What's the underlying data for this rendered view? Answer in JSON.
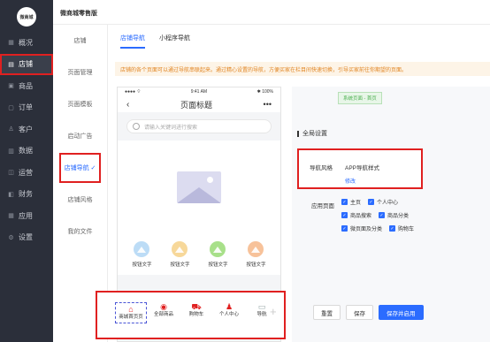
{
  "sidebar": {
    "logo_text": "微商城",
    "items": [
      {
        "icon": "grid-icon",
        "label": "概况"
      },
      {
        "icon": "store-icon",
        "label": "店铺"
      },
      {
        "icon": "goods-icon",
        "label": "商品"
      },
      {
        "icon": "order-icon",
        "label": "订单"
      },
      {
        "icon": "customer-icon",
        "label": "客户"
      },
      {
        "icon": "data-icon",
        "label": "数据"
      },
      {
        "icon": "marketing-icon",
        "label": "运营"
      },
      {
        "icon": "finance-icon",
        "label": "财务"
      },
      {
        "icon": "apps-icon",
        "label": "应用"
      },
      {
        "icon": "settings-icon",
        "label": "设置"
      }
    ]
  },
  "header": {
    "brand": "微商城零售版"
  },
  "subnav": {
    "items": [
      "店铺",
      "页面管理",
      "页面模板",
      "启动广告",
      "店铺导航 ✓",
      "店铺风格",
      "我的文件"
    ]
  },
  "tabs": [
    "店铺导航",
    "小程序导航"
  ],
  "notice": "店铺的各个页面可以通过导航串联起来。通过精心设置的导航，方便买家在栏目间快速切换，引导买家前往你期望的页面。",
  "phone": {
    "status_left": "●●●● ⌔",
    "status_time": "9:41 AM",
    "status_right": "✱ 100%",
    "title": "页面标题",
    "search_placeholder": "请输入关键词进行搜索",
    "buttons": [
      {
        "label": "按钮文字",
        "color": "#bcdcf6"
      },
      {
        "label": "按钮文字",
        "color": "#f7d89a"
      },
      {
        "label": "按钮文字",
        "color": "#a8e08a"
      },
      {
        "label": "按钮文字",
        "color": "#f7c29a"
      }
    ]
  },
  "bottom_nav": [
    {
      "icon": "home-icon",
      "label": "商城首页页"
    },
    {
      "icon": "all-goods-icon",
      "label": "全部商品"
    },
    {
      "icon": "cart-icon",
      "label": "购物车"
    },
    {
      "icon": "user-icon",
      "label": "个人中心"
    },
    {
      "icon": "guide-icon",
      "label": "导航"
    }
  ],
  "bottom_nav_add": "+",
  "panel": {
    "badge": "系统页面 - 首页",
    "section_title": "全局设置",
    "nav_style_label": "导航风格",
    "nav_style_value": "APP导航样式",
    "edit_link": "修改",
    "apply_label": "应用页面",
    "apply_rows": [
      [
        "主页",
        "个人中心"
      ],
      [
        "商品搜索",
        "商品分类"
      ],
      [
        "微页面及分类",
        "购物车"
      ]
    ]
  },
  "actions": [
    "重置",
    "保存",
    "保存并启用"
  ]
}
